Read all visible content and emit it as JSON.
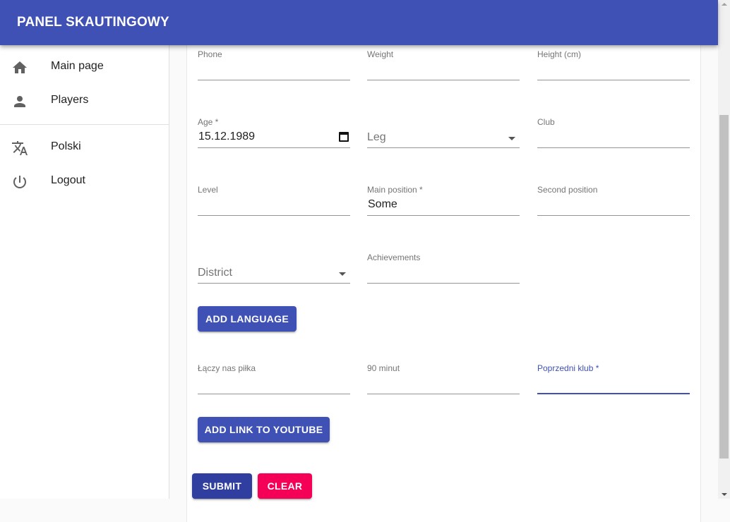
{
  "app": {
    "title": "PANEL SKAUTINGOWY"
  },
  "nav": {
    "main_page": "Main page",
    "players": "Players",
    "language": "Polski",
    "logout": "Logout"
  },
  "form": {
    "phone_label": "Phone",
    "weight_label": "Weight",
    "height_label": "Height (cm)",
    "age_label": "Age *",
    "age_value": "15.12.1989",
    "leg_placeholder": "Leg",
    "club_label": "Club",
    "level_label": "Level",
    "main_position_label": "Main position *",
    "main_position_value": "Some",
    "second_position_label": "Second position",
    "district_placeholder": "District",
    "achievements_label": "Achievements",
    "add_language": "ADD LANGUAGE",
    "laczy_label": "Łączy nas piłka",
    "minut_label": "90 minut",
    "poprzedni_label": "Poprzedni klub *",
    "add_link": "ADD LINK TO YOUTUBE",
    "submit": "SUBMIT",
    "clear": "CLEAR"
  }
}
